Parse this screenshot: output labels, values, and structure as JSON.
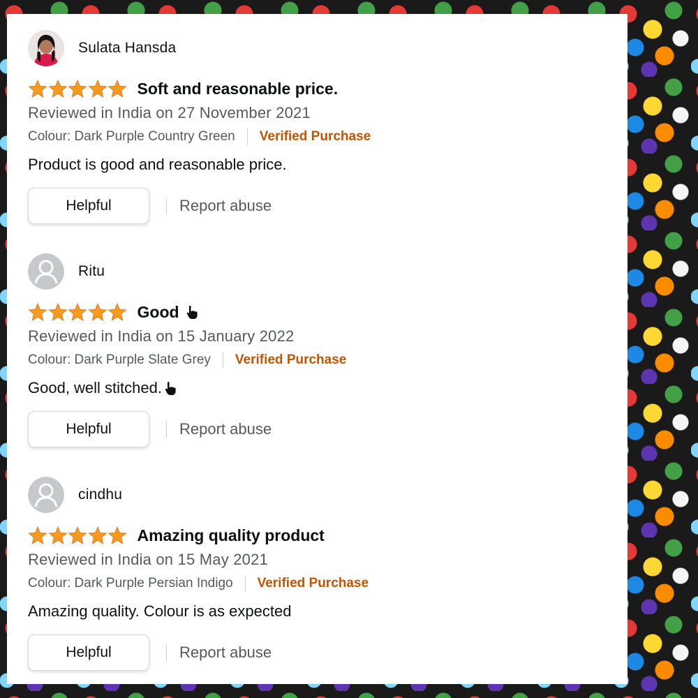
{
  "colors": {
    "star": "#f79a1f",
    "verified": "#c45500",
    "secondary_text": "#565959",
    "primary_text": "#0f1111"
  },
  "reviews": [
    {
      "reviewer": "Sulata Hansda",
      "avatar": "profile-photo",
      "rating": 5,
      "title": "Soft and reasonable price.",
      "date": "Reviewed in India on 27 November 2021",
      "colour": "Colour: Dark Purple Country Green",
      "verified": "Verified Purchase",
      "body": "Product is good and reasonable price.",
      "helpful": "Helpful",
      "report": "Report abuse"
    },
    {
      "reviewer": "Ritu",
      "avatar": "default-user-icon",
      "rating": 5,
      "title": "Good",
      "title_icon": "pointing-hand-icon",
      "date": "Reviewed in India on 15 January 2022",
      "colour": "Colour: Dark Purple Slate Grey",
      "verified": "Verified Purchase",
      "body": "Good, well stitched.",
      "body_icon": "pointing-hand-icon",
      "helpful": "Helpful",
      "report": "Report abuse"
    },
    {
      "reviewer": "cindhu",
      "avatar": "default-user-icon",
      "rating": 5,
      "title": "Amazing quality product",
      "date": "Reviewed in India on 15 May 2021",
      "colour": "Colour: Dark Purple Persian Indigo",
      "verified": "Verified Purchase",
      "body": "Amazing quality. Colour is as expected",
      "helpful": "Helpful",
      "report": "Report abuse"
    }
  ]
}
